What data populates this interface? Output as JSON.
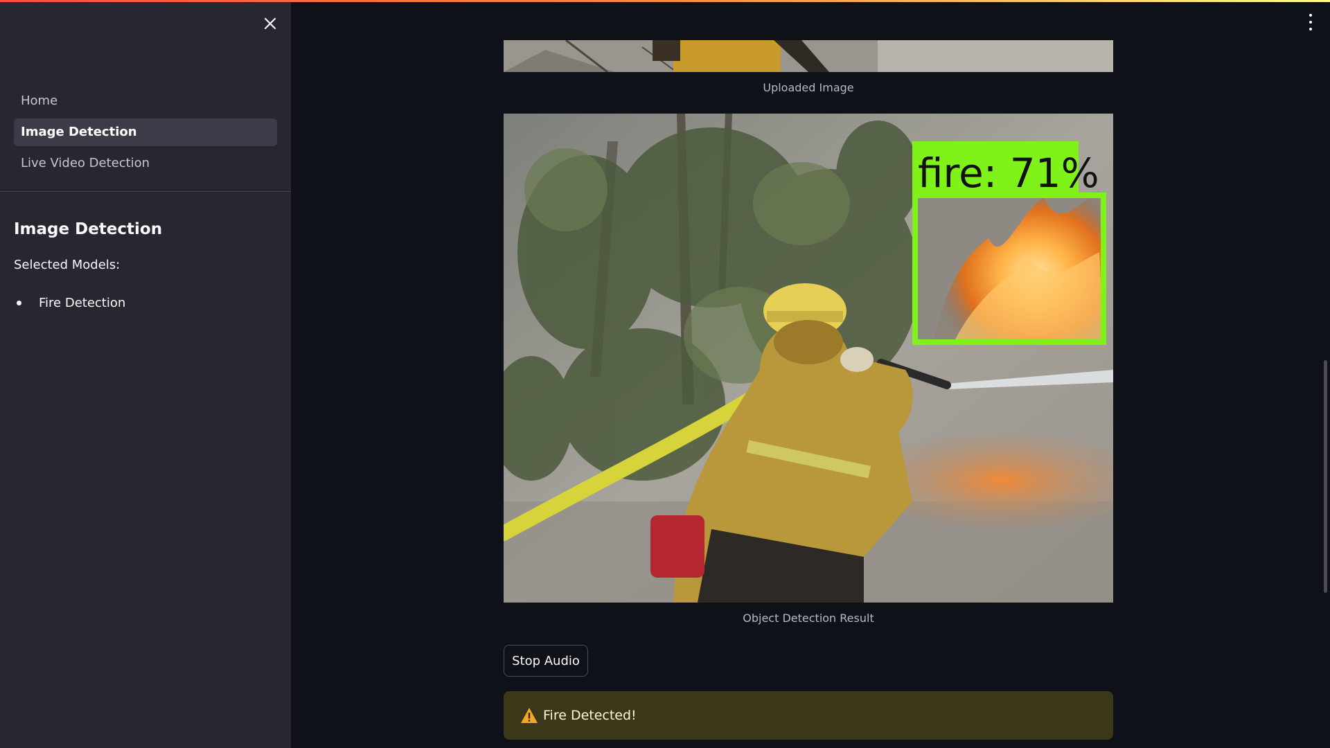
{
  "sidebar": {
    "nav": [
      {
        "label": "Home"
      },
      {
        "label": "Image Detection"
      },
      {
        "label": "Live Video Detection"
      }
    ],
    "heading": "Image Detection",
    "selected_label": "Selected Models:",
    "models": [
      "Fire Detection"
    ]
  },
  "main": {
    "uploaded_caption": "Uploaded Image",
    "detection": {
      "label": "fire: 71%",
      "class": "fire",
      "confidence": 0.71
    },
    "result_caption": "Object Detection Result",
    "stop_audio_label": "Stop Audio",
    "alert_text": "Fire Detected!"
  },
  "colors": {
    "sidebar_bg": "#262730",
    "main_bg": "#0e1117",
    "bbox": "#7ff21a",
    "alert_bg": "#3b381a",
    "warning_icon": "#f5a623"
  },
  "icons": [
    "close-icon",
    "more-vert-icon",
    "warning-icon"
  ]
}
